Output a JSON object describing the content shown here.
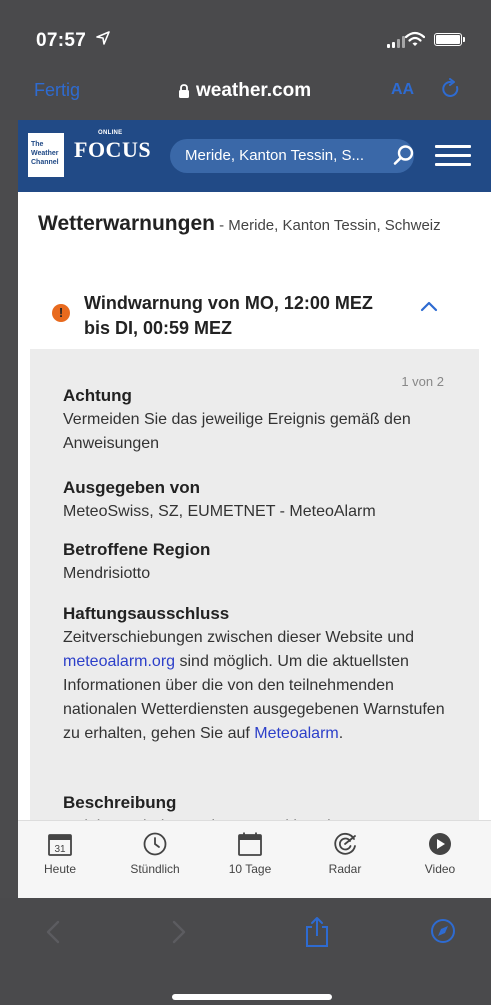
{
  "status": {
    "time": "07:57"
  },
  "safari": {
    "done_label": "Fertig",
    "url": "weather.com",
    "text_size_label": "AA"
  },
  "site": {
    "logo_twc": [
      "The",
      "Weather",
      "Channel"
    ],
    "logo_focus": "FOCUS",
    "logo_online": "ONLINE",
    "search_text": "Meride, Kanton Tessin, S..."
  },
  "page": {
    "title": "Wetterwarnungen",
    "title_suffix": " - Meride, Kanton Tessin, Schweiz"
  },
  "warning": {
    "title": "Windwarnung von MO, 12:00 MEZ bis DI, 00:59 MEZ",
    "count": "1 von 2",
    "sections": {
      "achtung": {
        "heading": "Achtung",
        "body": "Vermeiden Sie das jeweilige Ereignis gemäß den Anweisungen"
      },
      "ausgegeben": {
        "heading": "Ausgegeben von",
        "body": "MeteoSwiss, SZ, EUMETNET - MeteoAlarm"
      },
      "region": {
        "heading": "Betroffene Region",
        "body": "Mendrisiotto"
      },
      "haftung": {
        "heading": "Haftungsausschluss",
        "body_1": "Zeitverschiebungen zwischen dieser Website und ",
        "link_1": "meteoalarm.org",
        "body_2": " sind möglich. Um die aktuellsten Informationen über die von den teilnehmenden nationalen Wetterdiensten ausgegebenen Warnstufen zu erhalten, gehen Sie auf ",
        "link_2": "Meteoalarm",
        "body_3": "."
      },
      "beschreibung": {
        "heading": "Beschreibung",
        "body": "- Highest wind gusts in exposed locations:"
      }
    }
  },
  "tabs": {
    "heute": {
      "label": "Heute",
      "day": "31"
    },
    "stuendlich": {
      "label": "Stündlich"
    },
    "zehn_tage": {
      "label": "10 Tage"
    },
    "radar": {
      "label": "Radar"
    },
    "video": {
      "label": "Video"
    }
  },
  "colors": {
    "accent": "#2e6bd1",
    "header": "#214a86",
    "warning": "#e86a1e",
    "link": "#2c3fc9"
  }
}
